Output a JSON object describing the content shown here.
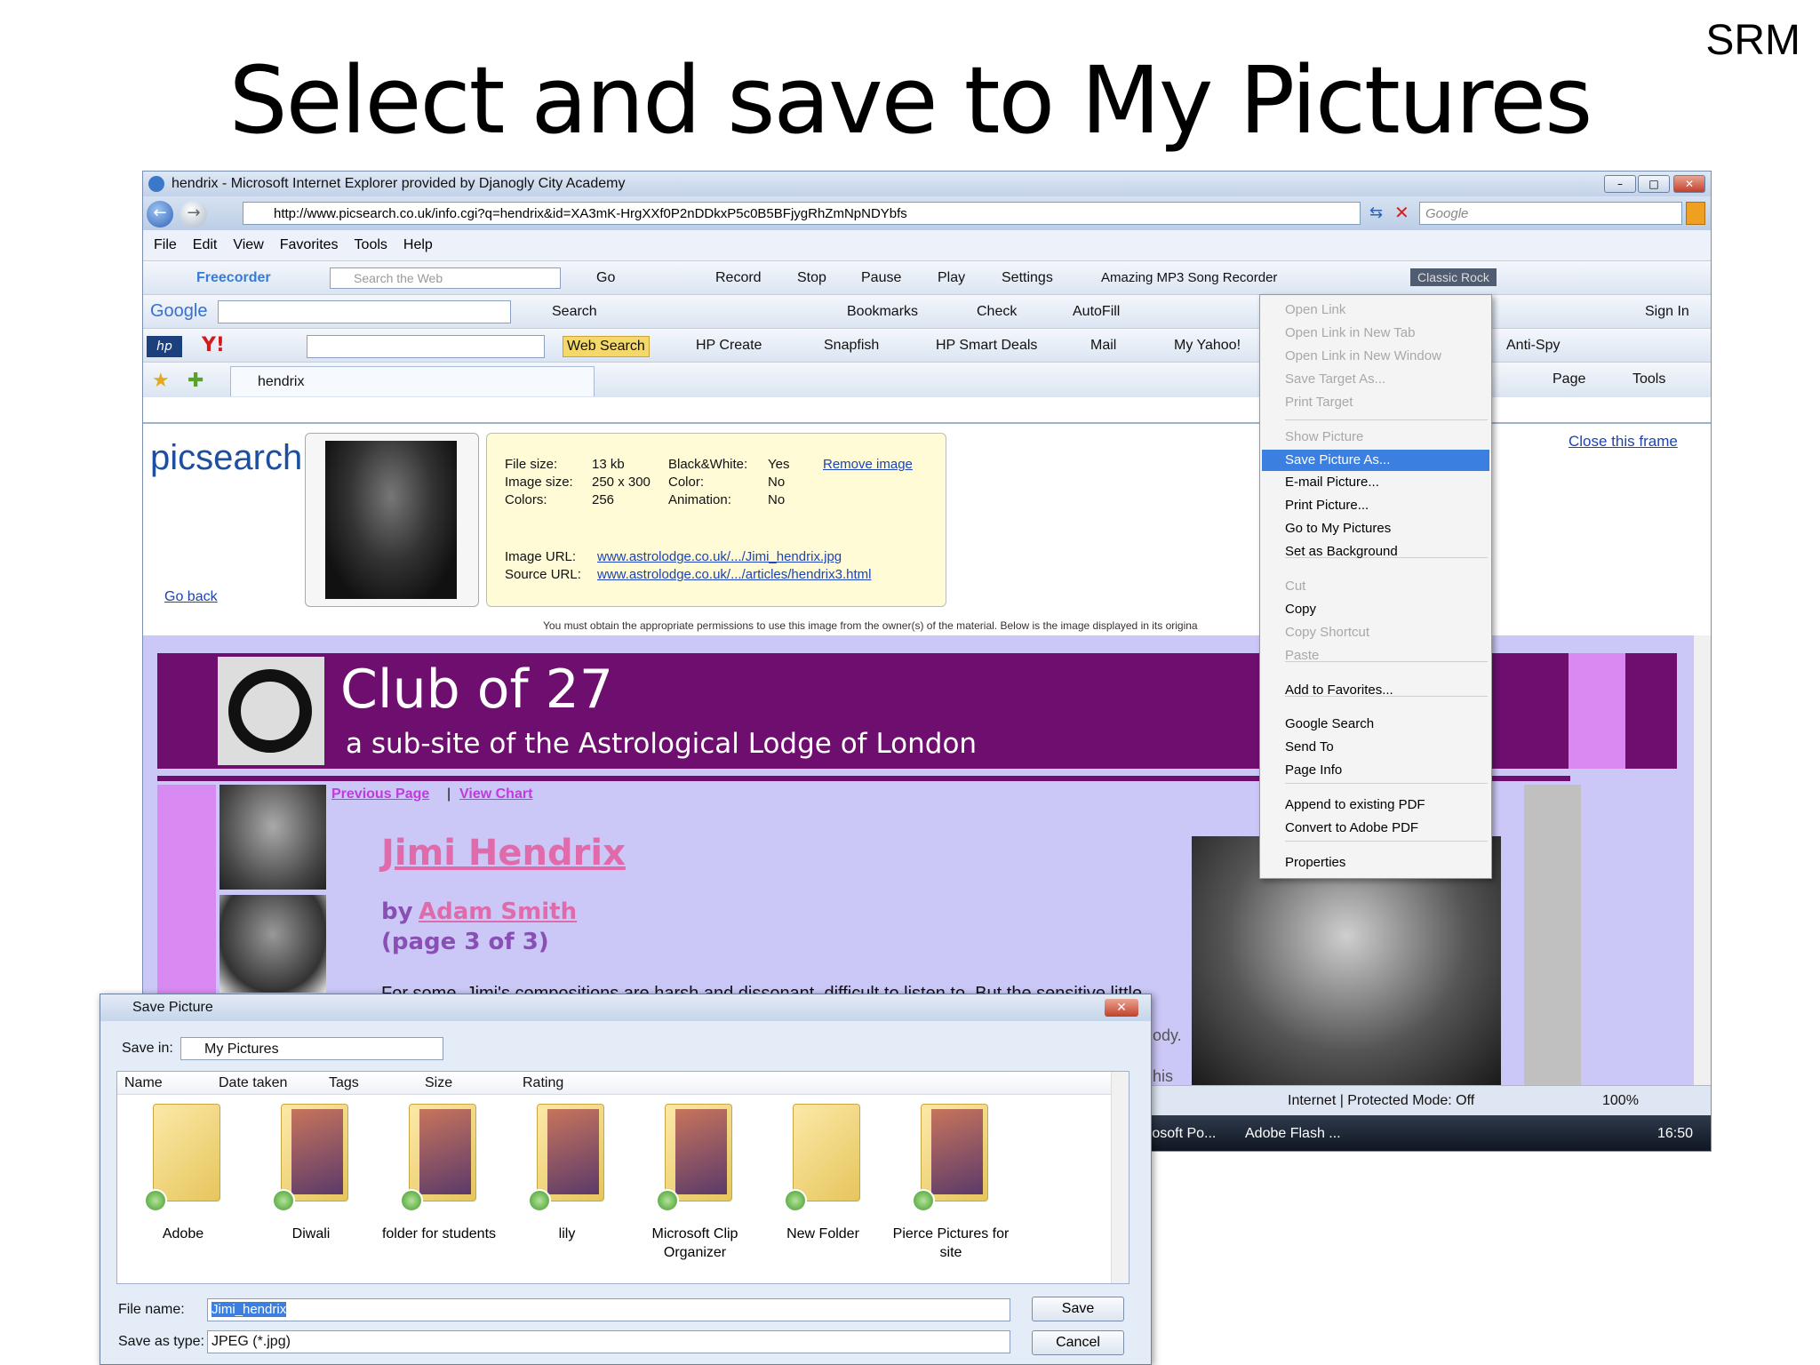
{
  "slide": {
    "title": "Select and save to My Pictures",
    "corner": "SRM"
  },
  "browser": {
    "title": "hendrix - Microsoft Internet Explorer provided by Djanogly City Academy",
    "url": "http://www.picsearch.co.uk/info.cgi?q=hendrix&id=XA3mK-HrgXXf0P2nDDkxP5c0B5BFjygRhZmNpNDYbfs",
    "search_placeholder": "Google",
    "menu": [
      "File",
      "Edit",
      "View",
      "Favorites",
      "Tools",
      "Help"
    ],
    "toolbar1": {
      "freecorder": "Freecorder",
      "search_web": "Search the Web",
      "go": "Go",
      "record": "Record",
      "stop": "Stop",
      "pause": "Pause",
      "play": "Play",
      "settings": "Settings",
      "mp3": "Amazing MP3 Song Recorder",
      "station": "Classic Rock"
    },
    "toolbar2": {
      "google": "Google",
      "search": "Search",
      "bookmarks": "Bookmarks",
      "check": "Check",
      "autofill": "AutoFill",
      "signin": "Sign In"
    },
    "toolbar3": {
      "web_search": "Web Search",
      "hp_create": "HP Create",
      "snapfish": "Snapfish",
      "hp_deals": "HP Smart Deals",
      "mail": "Mail",
      "my_yahoo": "My Yahoo!",
      "antispy": "Anti-Spy"
    },
    "tab": {
      "label": "hendrix",
      "page": "Page",
      "tools": "Tools"
    },
    "status": {
      "zone": "Internet | Protected Mode: Off",
      "zoom": "100%",
      "task1": "rosoft Po...",
      "task2": "Adobe Flash ...",
      "time": "16:50"
    }
  },
  "picsearch": {
    "logo": "picsearch",
    "go_back": "Go back",
    "close_frame": "Close this frame",
    "file_size_label": "File size:",
    "file_size": "13 kb",
    "image_size_label": "Image size:",
    "image_size": "250 x 300",
    "colors_label": "Colors:",
    "colors": "256",
    "bw_label": "Black&White:",
    "bw": "Yes",
    "color_label": "Color:",
    "color": "No",
    "animation_label": "Animation:",
    "animation": "No",
    "remove": "Remove image",
    "image_url_label": "Image URL:",
    "image_url": "www.astrolodge.co.uk/.../Jimi_hendrix.jpg",
    "source_url_label": "Source URL:",
    "source_url": "www.astrolodge.co.uk/.../articles/hendrix3.html",
    "notice": "You must obtain the appropriate permissions to use this image from the owner(s) of the material. Below is the image displayed in its origina"
  },
  "club": {
    "title": "Club of 27",
    "subtitle": "a sub-site of the Astrological Lodge of London",
    "prev": "Previous Page",
    "sep": "|",
    "chart": "View Chart",
    "heading": "Jimi Hendrix",
    "by": "by",
    "author": "Adam Smith",
    "page": "(page 3 of 3)",
    "cut_text": "For some, Jimi's compositions are harsh and dissonant, difficult to listen to. But the sensitive little",
    "right1": "ody.",
    "right2": "his"
  },
  "context_menu": [
    {
      "label": "Open Link",
      "state": "disabled"
    },
    {
      "label": "Open Link in New Tab",
      "state": "disabled"
    },
    {
      "label": "Open Link in New Window",
      "state": "disabled"
    },
    {
      "label": "Save Target As...",
      "state": "disabled"
    },
    {
      "label": "Print Target",
      "state": "disabled"
    },
    {
      "label": "Show Picture",
      "state": "disabled"
    },
    {
      "label": "Save Picture As...",
      "state": "selected"
    },
    {
      "label": "E-mail Picture...",
      "state": "normal"
    },
    {
      "label": "Print Picture...",
      "state": "normal"
    },
    {
      "label": "Go to My Pictures",
      "state": "normal"
    },
    {
      "label": "Set as Background",
      "state": "normal"
    },
    {
      "label": "Cut",
      "state": "disabled"
    },
    {
      "label": "Copy",
      "state": "normal"
    },
    {
      "label": "Copy Shortcut",
      "state": "disabled"
    },
    {
      "label": "Paste",
      "state": "disabled"
    },
    {
      "label": "Add to Favorites...",
      "state": "normal"
    },
    {
      "label": "Google Search",
      "state": "normal"
    },
    {
      "label": "Send To",
      "state": "normal"
    },
    {
      "label": "Page Info",
      "state": "normal"
    },
    {
      "label": "Append to existing PDF",
      "state": "normal"
    },
    {
      "label": "Convert to Adobe PDF",
      "state": "normal"
    },
    {
      "label": "Properties",
      "state": "normal"
    }
  ],
  "dialog": {
    "title": "Save Picture",
    "save_in_label": "Save in:",
    "save_in": "My Pictures",
    "columns": [
      "Name",
      "Date taken",
      "Tags",
      "Size",
      "Rating"
    ],
    "folders": [
      "Adobe",
      "Diwali",
      "folder for students",
      "lily",
      "Microsoft Clip Organizer",
      "New Folder",
      "Pierce Pictures for site"
    ],
    "file_name_label": "File name:",
    "file_name": "Jimi_hendrix",
    "save_type_label": "Save as type:",
    "save_type": "JPEG (*.jpg)",
    "save": "Save",
    "cancel": "Cancel"
  }
}
